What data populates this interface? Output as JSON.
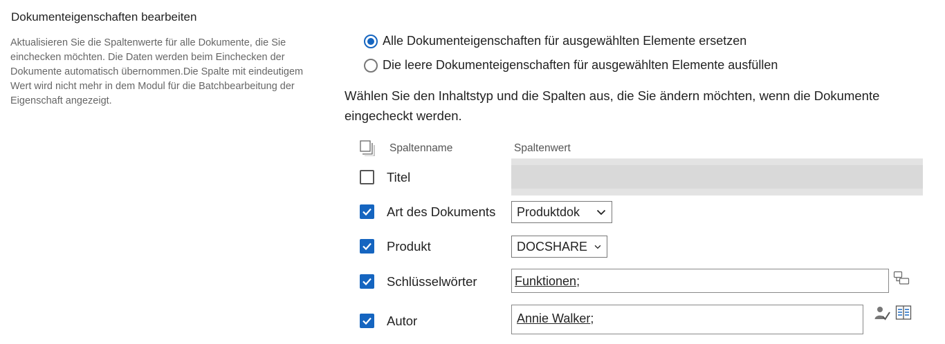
{
  "section": {
    "title": "Dokumenteigenschaften bearbeiten",
    "description": "Aktualisieren Sie die Spaltenwerte für alle Dokumente, die Sie einchecken möchten. Die Daten werden beim Einchecken der Dokumente automatisch übernommen.Die Spalte mit eindeutigem Wert wird nicht mehr in dem Modul für die Batchbearbeitung der Eigenschaft angezeigt."
  },
  "options": {
    "replace_all": {
      "label": "Alle Dokumenteigenschaften für ausgewählten Elemente ersetzen",
      "selected": true
    },
    "fill_empty": {
      "label": "Die leere Dokumenteigenschaften für ausgewählten Elemente ausfüllen",
      "selected": false
    }
  },
  "instruction": "Wählen Sie den Inhaltstyp und die Spalten aus, die Sie ändern möchten, wenn die Dokumente eingecheckt werden.",
  "table": {
    "header_name": "Spaltenname",
    "header_value": "Spaltenwert"
  },
  "rows": {
    "titel": {
      "label": "Titel",
      "checked": false
    },
    "art": {
      "label": "Art des Dokuments",
      "checked": true,
      "value": "Produktdok"
    },
    "produkt": {
      "label": "Produkt",
      "checked": true,
      "value": "DOCSHARE"
    },
    "keywords": {
      "label": "Schlüsselwörter",
      "checked": true,
      "token": "Funktionen",
      "separator": ";"
    },
    "autor": {
      "label": "Autor",
      "checked": true,
      "token": "Annie Walker",
      "separator": ";"
    }
  },
  "icons": {
    "copy": "copy-icon",
    "taxonomy": "tags-icon",
    "check_names": "check-names-icon",
    "address_book": "address-book-icon"
  },
  "colors": {
    "accent": "#1565c0",
    "disabled": "#e3e3e3"
  }
}
